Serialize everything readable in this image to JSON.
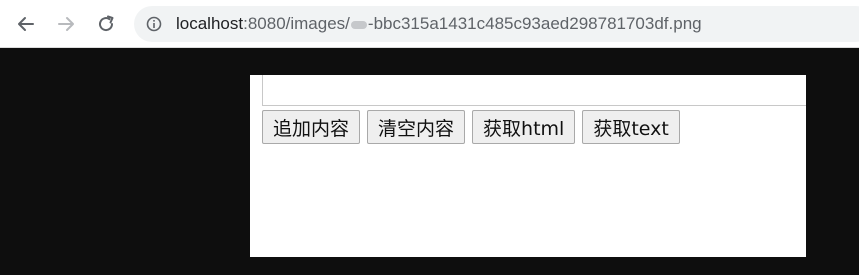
{
  "browser": {
    "url_host": "localhost",
    "url_port_path": ":8080/images/",
    "url_after_blur": "-bbc315a1431c485c93aed298781703df.png"
  },
  "page": {
    "buttons": [
      {
        "label": "追加内容"
      },
      {
        "label": "清空内容"
      },
      {
        "label": "获取html"
      },
      {
        "label": "获取text"
      }
    ]
  },
  "icons": {
    "back": "arrow-left",
    "forward": "arrow-right",
    "reload": "reload",
    "site_info": "info-circle"
  }
}
